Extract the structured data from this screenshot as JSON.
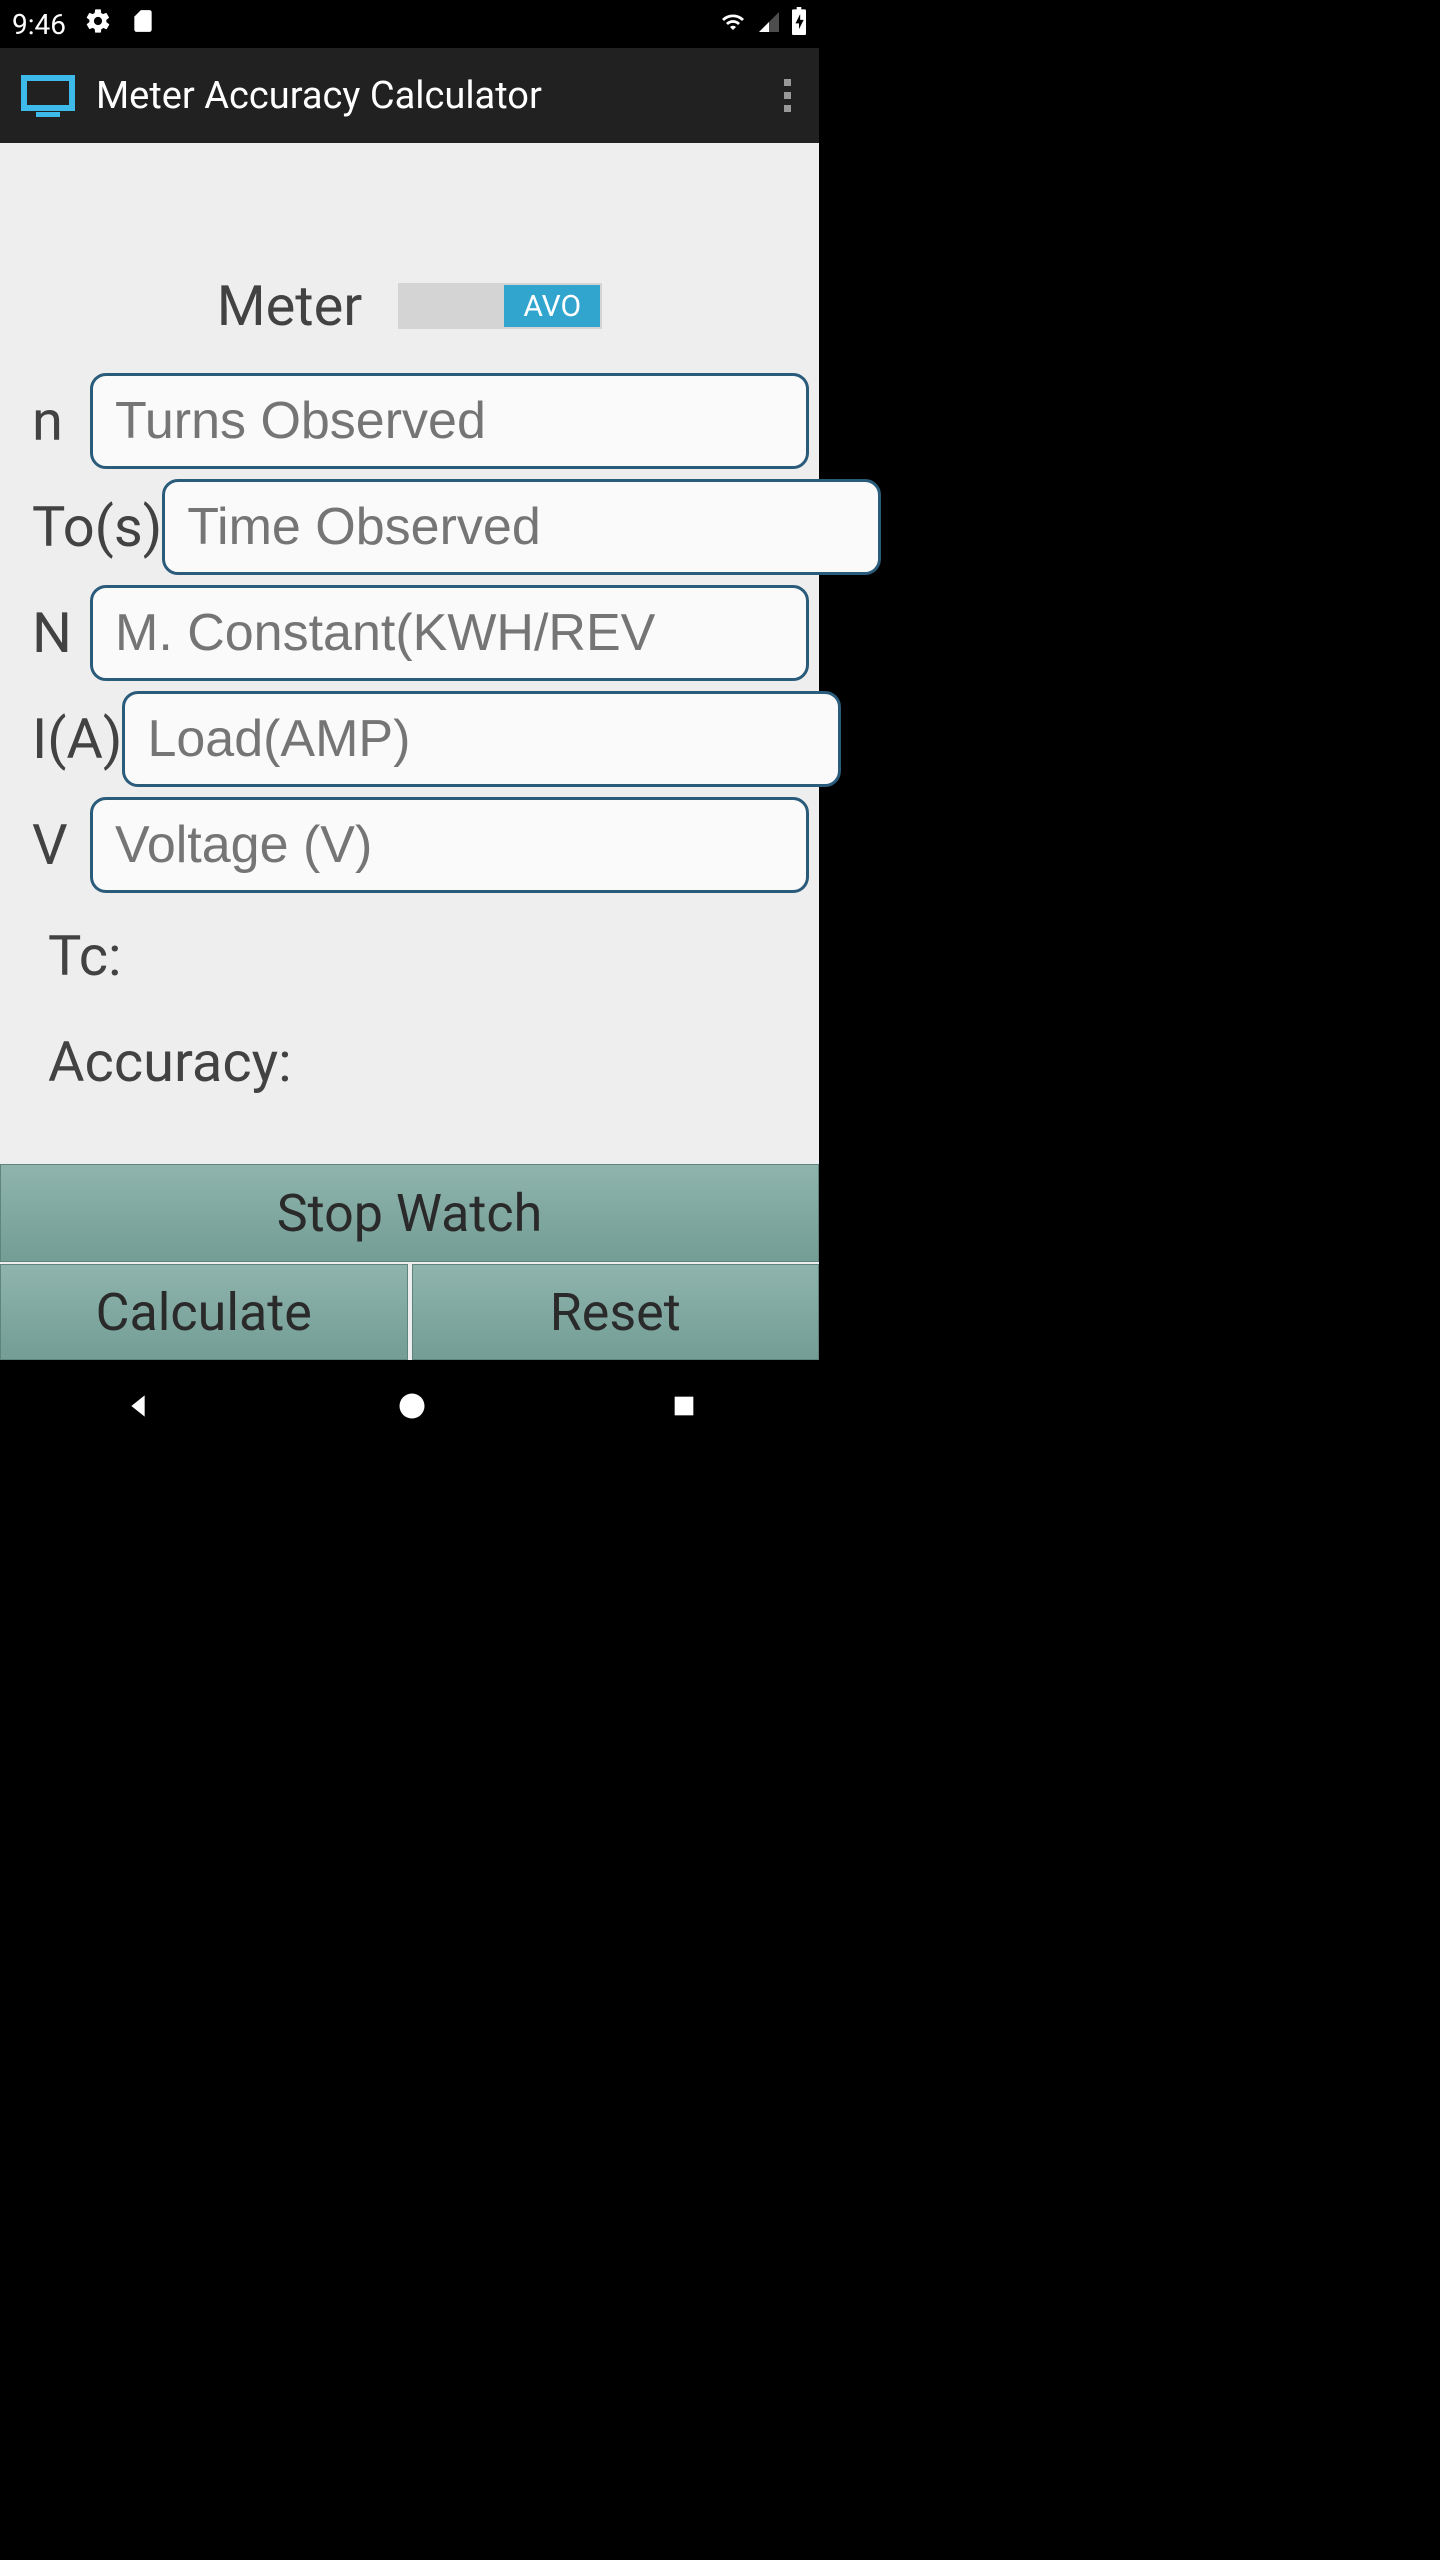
{
  "status": {
    "time": "9:46"
  },
  "app": {
    "title": "Meter Accuracy Calculator"
  },
  "meter": {
    "label": "Meter",
    "toggle_value": "AVO"
  },
  "fields": {
    "n": {
      "label": "n",
      "placeholder": "Turns Observed"
    },
    "to": {
      "label": "To(s)",
      "placeholder": "Time Observed"
    },
    "N": {
      "label": "N",
      "placeholder": "M. Constant(KWH/REV"
    },
    "i": {
      "label": "I(A)",
      "placeholder": "Load(AMP)"
    },
    "v": {
      "label": "V",
      "placeholder": "Voltage (V)"
    }
  },
  "outputs": {
    "tc": "Tc:",
    "accuracy": "Accuracy:"
  },
  "buttons": {
    "stopwatch": "Stop Watch",
    "calculate": "Calculate",
    "reset": "Reset"
  }
}
